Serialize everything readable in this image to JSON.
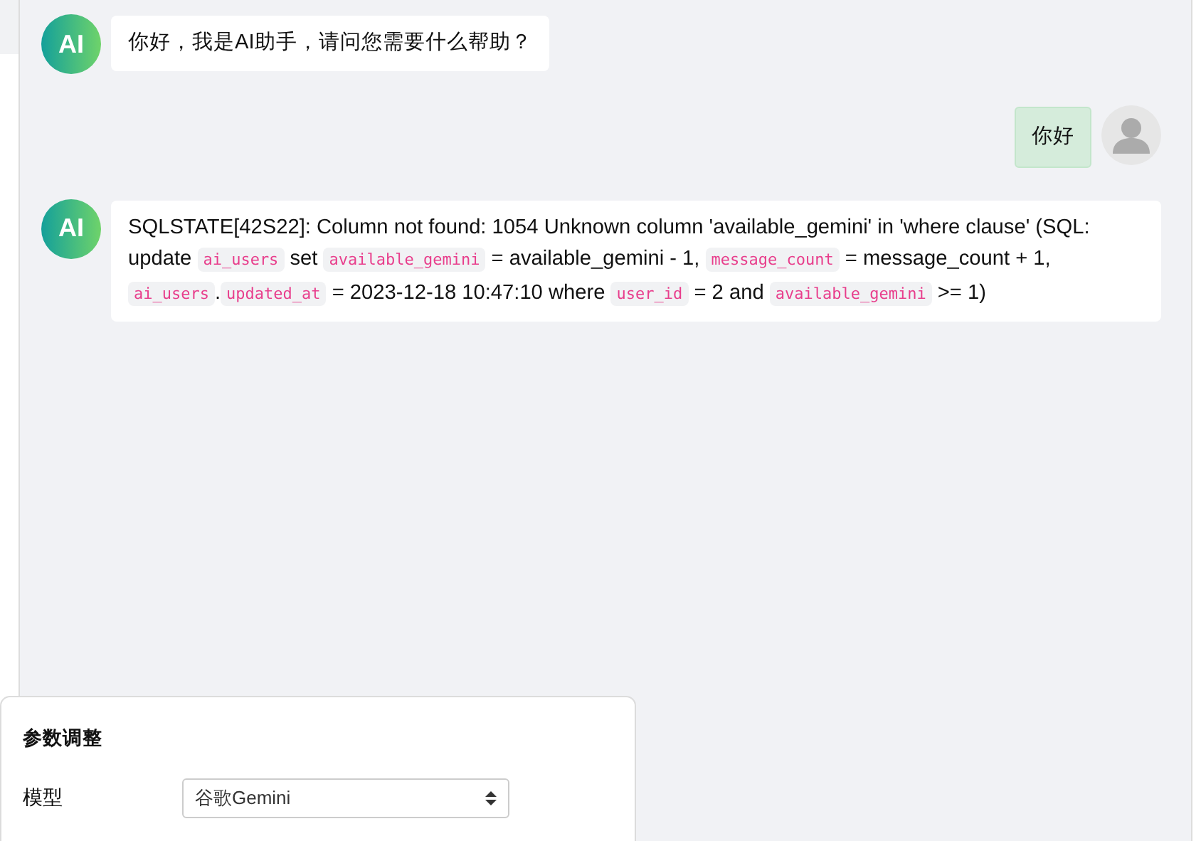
{
  "messages": [
    {
      "kind": "ai",
      "avatar": "AI",
      "parts": [
        {
          "kind": "text",
          "text": "你好，我是AI助手，请问您需要什么帮助？"
        }
      ]
    },
    {
      "kind": "user",
      "parts": [
        {
          "kind": "text",
          "text": "你好"
        }
      ]
    },
    {
      "kind": "ai",
      "avatar": "AI",
      "parts": [
        {
          "kind": "text",
          "text": "SQLSTATE[42S22]: Column not found: 1054 Unknown column 'available_gemini' in 'where clause' (SQL: update "
        },
        {
          "kind": "code",
          "text": "ai_users"
        },
        {
          "kind": "text",
          "text": " set "
        },
        {
          "kind": "code",
          "text": "available_gemini"
        },
        {
          "kind": "text",
          "text": " = available_gemini - 1, "
        },
        {
          "kind": "code",
          "text": "message_count"
        },
        {
          "kind": "text",
          "text": " = message_count + 1, "
        },
        {
          "kind": "code",
          "text": "ai_users"
        },
        {
          "kind": "text",
          "text": "."
        },
        {
          "kind": "code",
          "text": "updated_at"
        },
        {
          "kind": "text",
          "text": " = 2023-12-18 10:47:10 where "
        },
        {
          "kind": "code",
          "text": "user_id"
        },
        {
          "kind": "text",
          "text": " = 2 and "
        },
        {
          "kind": "code",
          "text": "available_gemini"
        },
        {
          "kind": "text",
          "text": " >= 1)"
        }
      ]
    }
  ],
  "settings_panel": {
    "title": "参数调整",
    "fields": [
      {
        "label": "模型",
        "value": "谷歌Gemini"
      }
    ]
  }
}
